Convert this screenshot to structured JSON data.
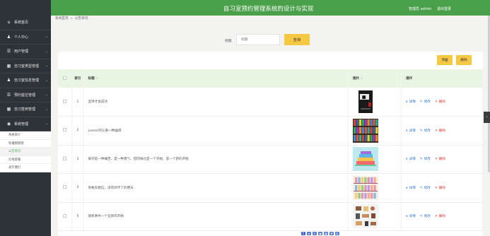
{
  "app": {
    "title": "自习室预约管理系统的设计与实现",
    "user": "管理员 admin",
    "logout": "退出登录"
  },
  "breadcrumb": {
    "home": "系统首页",
    "sep": "»",
    "current": "公告资讯"
  },
  "sidebar": {
    "items": [
      {
        "label": "系统首页",
        "icon": "home-icon",
        "glyph": "⌂",
        "has_children": false
      },
      {
        "label": "个人中心",
        "icon": "person-icon",
        "glyph": "♟",
        "has_children": true
      },
      {
        "label": "用户管理",
        "icon": "user-list-icon",
        "glyph": "☰",
        "has_children": true
      },
      {
        "label": "自习室类型管理",
        "icon": "grid-icon",
        "glyph": "▦",
        "has_children": true
      },
      {
        "label": "自习室信息管理",
        "icon": "person-icon",
        "glyph": "♟",
        "has_children": true
      },
      {
        "label": "预约座位管理",
        "icon": "list-icon",
        "glyph": "☰",
        "has_children": true
      },
      {
        "label": "自习签到管理",
        "icon": "grid-icon",
        "glyph": "▦",
        "has_children": true
      },
      {
        "label": "系统管理",
        "icon": "location-icon",
        "glyph": "◉",
        "has_children": true,
        "open": true
      }
    ],
    "sub_items": [
      {
        "label": "系统简介",
        "active": false
      },
      {
        "label": "轮播图管理",
        "active": false
      },
      {
        "label": "公告资讯",
        "active": true
      },
      {
        "label": "在线客服",
        "active": false
      },
      {
        "label": "关于我们",
        "active": false
      }
    ]
  },
  "search": {
    "label": "标题",
    "placeholder": "标题",
    "button": "查询"
  },
  "toolbar": {
    "add": "添加",
    "delete": "删除"
  },
  "table": {
    "headers": {
      "index": "索引",
      "title": "标题",
      "image": "图片",
      "ops": "操作"
    },
    "ops": {
      "detail": "详情",
      "edit": "修改",
      "delete": "删除"
    },
    "rows": [
      {
        "index": "1",
        "title": "坚持才会成功",
        "thumb": "book-cover"
      },
      {
        "index": "2",
        "title": "Lesser的认真一种幽闭",
        "thumb": "bookshelf"
      },
      {
        "index": "3",
        "title": "离开是一种痛苦、是一种勇气、但同样也是一个开始、是一个新的开始",
        "thumb": "books-stack"
      },
      {
        "index": "4",
        "title": "你要去相信，没有到不了的明天",
        "thumb": "pastel-shelf"
      },
      {
        "index": "5",
        "title": "随机事件一个全新的开始",
        "thumb": "flat-illustration"
      }
    ]
  },
  "colors": {
    "topbar": "#4aa04a",
    "sidebar": "#2e3338",
    "accent_button": "#f5c842",
    "table_header": "#e8f5e3",
    "link": "#2c77c5",
    "danger": "#d93434"
  }
}
